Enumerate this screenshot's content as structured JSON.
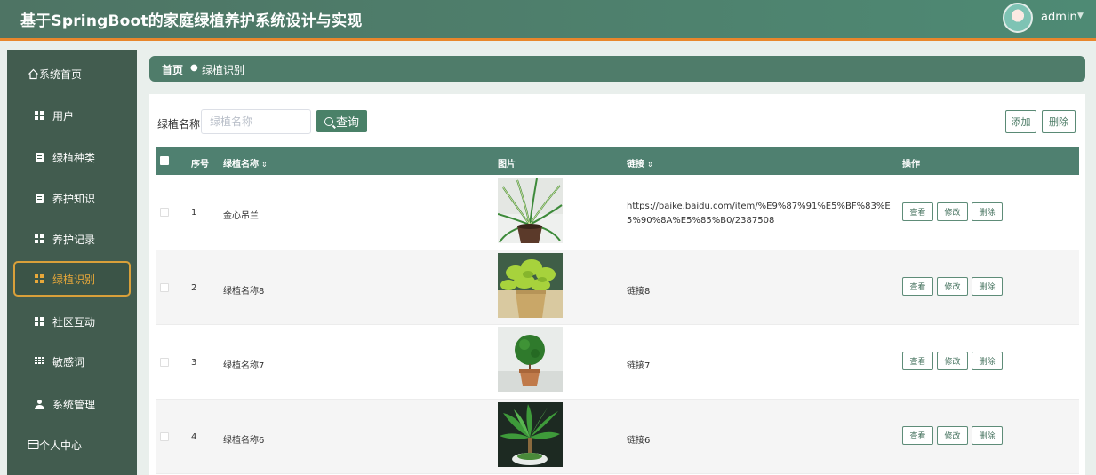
{
  "header": {
    "title": "基于SpringBoot的家庭绿植养护系统设计与实现",
    "user": "admin",
    "caret_icon": "caret-down-icon",
    "avatar_icon": "avatar"
  },
  "sidebar": {
    "items": [
      {
        "label": "系统首页",
        "icon": "home-icon"
      },
      {
        "label": "用户",
        "icon": "grid-icon"
      },
      {
        "label": "绿植种类",
        "icon": "document-icon"
      },
      {
        "label": "养护知识",
        "icon": "document-icon"
      },
      {
        "label": "养护记录",
        "icon": "grid-icon"
      },
      {
        "label": "绿植识别",
        "icon": "grid-icon",
        "active": true
      },
      {
        "label": "社区互动",
        "icon": "grid-icon"
      },
      {
        "label": "敏感词",
        "icon": "list-icon"
      },
      {
        "label": "系统管理",
        "icon": "user-icon"
      },
      {
        "label": "个人中心",
        "icon": "profile-icon"
      }
    ],
    "active_color": "#e8a83a"
  },
  "breadcrumb": {
    "home": "首页",
    "separator": "●",
    "current": "绿植识别"
  },
  "search": {
    "label": "绿植名称",
    "placeholder": "绿植名称",
    "value": "",
    "button": "查询"
  },
  "toolbar": {
    "add": "添加",
    "delete": "删除"
  },
  "table": {
    "columns": {
      "index": "序号",
      "name": "绿植名称",
      "image": "图片",
      "link": "链接",
      "actions": "操作"
    },
    "sort_icon": "⇕",
    "rows": [
      {
        "index": "1",
        "name": "金心吊兰",
        "link": "https://baike.baidu.com/item/%E9%87%91%E5%BF%83%E5%90%8A%E5%85%B0/2387508",
        "image": "spider-plant-image"
      },
      {
        "index": "2",
        "name": "绿植名称8",
        "link": "链接8",
        "image": "pothos-plant-image"
      },
      {
        "index": "3",
        "name": "绿植名称7",
        "link": "链接7",
        "image": "topiary-plant-image"
      },
      {
        "index": "4",
        "name": "绿植名称6",
        "link": "链接6",
        "image": "money-tree-image"
      }
    ],
    "row_actions": {
      "view": "查看",
      "edit": "修改",
      "delete": "删除"
    }
  },
  "colors": {
    "header": "#4e7464",
    "header_accent": "#e8862c",
    "sidebar": "#425c4f",
    "primary": "#4a8168",
    "table_header": "#4f8070"
  }
}
